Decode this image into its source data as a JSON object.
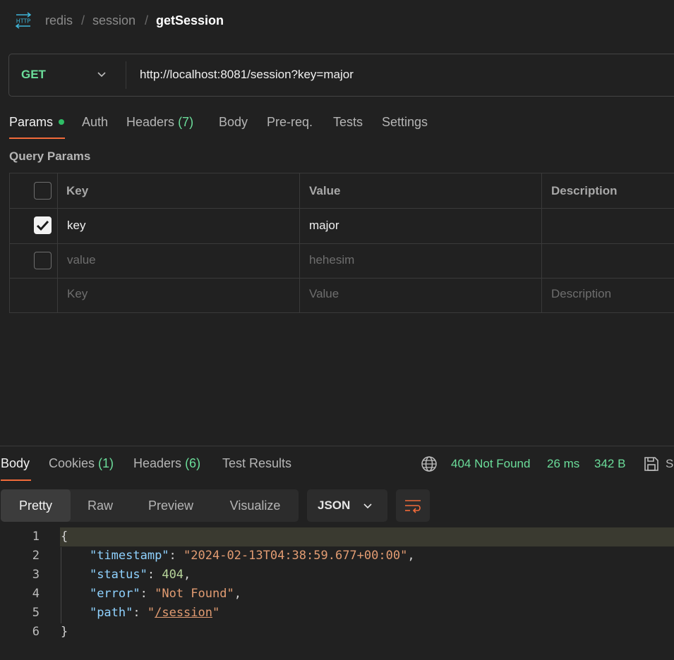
{
  "breadcrumb": {
    "icon_text": "HTTP",
    "items": [
      "redis",
      "/",
      "session",
      "/",
      "getSession"
    ]
  },
  "request": {
    "method": "GET",
    "url": "http://localhost:8081/session?key=major",
    "tabs": {
      "params": "Params",
      "auth": "Auth",
      "headers": "Headers",
      "headers_count": "(7)",
      "body": "Body",
      "prereq": "Pre-req.",
      "tests": "Tests",
      "settings": "Settings"
    },
    "query_params_title": "Query Params",
    "table": {
      "headers": [
        "Key",
        "Value",
        "Description"
      ],
      "rows": [
        {
          "checked": true,
          "key": "key",
          "value": "major",
          "description": ""
        },
        {
          "checked": false,
          "key": "value",
          "value": "hehesim",
          "description": ""
        }
      ],
      "placeholder": {
        "key": "Key",
        "value": "Value",
        "description": "Description"
      }
    }
  },
  "response": {
    "tabs": {
      "body": "Body",
      "cookies": "Cookies",
      "cookies_count": "(1)",
      "headers": "Headers",
      "headers_count": "(6)",
      "test_results": "Test Results"
    },
    "status": "404 Not Found",
    "time": "26 ms",
    "size": "342 B",
    "save_label": "S",
    "view_modes": [
      "Pretty",
      "Raw",
      "Preview",
      "Visualize"
    ],
    "format": "JSON",
    "code": {
      "line_numbers": [
        "1",
        "2",
        "3",
        "4",
        "5",
        "6"
      ],
      "open_brace": "{",
      "close_brace": "}",
      "timestamp_key": "\"timestamp\"",
      "timestamp_value": "\"2024-02-13T04:38:59.677+00:00\"",
      "status_key": "\"status\"",
      "status_value": "404",
      "error_key": "\"error\"",
      "error_value": "\"Not Found\"",
      "path_key": "\"path\"",
      "path_quote_open": "\"",
      "path_value": "/session",
      "path_quote_close": "\""
    }
  },
  "colors": {
    "background": "#212121",
    "accent_orange": "#f26b3a",
    "success_green": "#6bdd9a"
  }
}
